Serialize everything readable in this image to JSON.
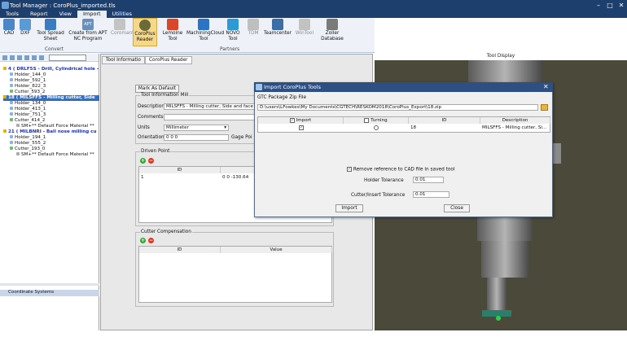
{
  "window": {
    "title": "Tool Manager : CoroPlus_imported.tls",
    "controls": [
      "–",
      "□",
      "✕"
    ]
  },
  "menu": {
    "tabs": [
      "Tools",
      "Report",
      "View",
      "Import",
      "Utilities"
    ],
    "active": "Import"
  },
  "ribbon": {
    "convert": {
      "label": "Convert",
      "items": [
        "CAD",
        "DXF",
        "Tool Spread Sheet",
        "Create from APT NC Program"
      ]
    },
    "partners": {
      "label": "Partners",
      "items": [
        "Coromant",
        "CoroPlus Reader",
        "Lemoine Tool",
        "MachiningCloud Tool",
        "NOVO Tool",
        "TDM",
        "Teamcenter",
        "WinTool",
        "Zoller Database"
      ]
    },
    "apt_badge": "APT"
  },
  "tree": {
    "rows": [
      {
        "text": "4 ( DRLF5S - Drill, Cylindrical hole -",
        "style": "hl"
      },
      {
        "text": "Holder_144_0",
        "style": ""
      },
      {
        "text": "Holder_592_1",
        "style": ""
      },
      {
        "text": "Holder_822_3",
        "style": ""
      },
      {
        "text": "Cutter_593_2",
        "style": ""
      },
      {
        "text": "18 ( MILSFFS - Milling cutter, Side",
        "style": "sel"
      },
      {
        "text": "Holder_134_0",
        "style": ""
      },
      {
        "text": "Holder_413_1",
        "style": ""
      },
      {
        "text": "Holder_751_3",
        "style": ""
      },
      {
        "text": "Cutter_414_2",
        "style": ""
      },
      {
        "text": "SM+** Default Force Material **",
        "style": ""
      },
      {
        "text": "21 ( MILBNRI - Ball nose milling cu",
        "style": "hl"
      },
      {
        "text": "Holder_194_1",
        "style": ""
      },
      {
        "text": "Holder_555_2",
        "style": ""
      },
      {
        "text": "Cutter_193_0",
        "style": ""
      },
      {
        "text": "SM+** Default Force Material **",
        "style": ""
      }
    ],
    "coordinate_systems": "Coordinate Systems"
  },
  "tool_info": {
    "tabs": [
      "Tool Informatio",
      "CoroPlus Reader"
    ],
    "mark_default": "Mark As Default",
    "group_label": "Tool Information",
    "units_hint": "Mill",
    "description_label": "Description",
    "description_value": "MILSFFS - Milling cutter, Side and face m",
    "comments_label": "Comments",
    "units_label": "Units",
    "units_value": "Millimeter",
    "orientation_label": "Orientation",
    "orientation_value": "0 0 0",
    "gage_label": "Gage Poi",
    "driven_point": {
      "label": "Driven Point",
      "headers": [
        "ID",
        ""
      ],
      "rows": [
        [
          "1",
          "0 0 -130.64"
        ]
      ]
    },
    "cutter_comp": {
      "label": "Cutter Compensation",
      "headers": [
        "ID",
        "Value"
      ]
    }
  },
  "tool_display": {
    "title": "Tool Display"
  },
  "dialog": {
    "title": "Import CoroPlus Tools",
    "gtc_label": "GTC Package Zip File",
    "path": "D:\\users\\LFowkes\\My Documents\\CGTECH\\RESKOM2018\\CoroPlus_Export\\18.zip",
    "headers": [
      "Import",
      "Turning",
      "ID",
      "Description"
    ],
    "row": {
      "id": "18",
      "description": "MILSFFS - Milling cutter, Si..."
    },
    "remove_ref": "Remove reference to CAD file in saved tool",
    "holder_tol_label": "Holder Tolerance",
    "holder_tol_value": "0.01",
    "cutter_tol_label": "Cutter/Insert Tolerance",
    "cutter_tol_value": "0.01",
    "import_btn": "Import",
    "close_btn": "Close"
  },
  "colors": {
    "titlebar": "#1d3f6e",
    "dialog_title": "#2d4f82",
    "tool_bg": "#4b4a3a",
    "selection": "#2f6fca"
  }
}
